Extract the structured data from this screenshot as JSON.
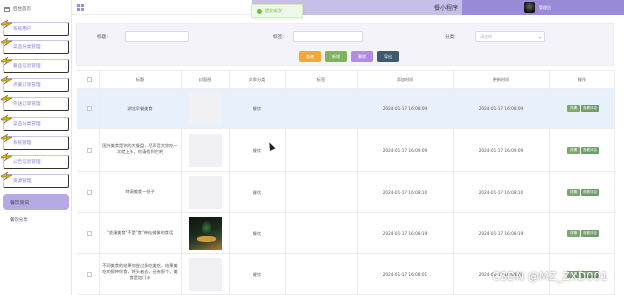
{
  "sidebar": {
    "home_label": "后台首页",
    "items": [
      {
        "label": "系统用户"
      },
      {
        "label": "菜品分类管理"
      },
      {
        "label": "餐品信息管理"
      },
      {
        "label": "点餐订单管理"
      },
      {
        "label": "外送订单管理"
      },
      {
        "label": "菜品分类管理"
      },
      {
        "label": "系统管理"
      },
      {
        "label": "公告信息管理"
      },
      {
        "label": "资源管理"
      }
    ],
    "active_item": "餐饮资讯",
    "sub_item": "餐饮分享"
  },
  "header": {
    "title": "餐小程序",
    "user_name": "管理员"
  },
  "toast": {
    "text": "提交成功!"
  },
  "search": {
    "field1_label": "标题:",
    "field2_label": "标签:",
    "field3_label": "分类:",
    "select_placeholder": "请选择",
    "buttons": {
      "search": "查询",
      "add": "新增",
      "delete": "删除",
      "export": "导出"
    }
  },
  "colors": {
    "accent_purple": "#9a8ad8",
    "btn_search": "#f3a735",
    "btn_add": "#7fb35f",
    "btn_delete": "#b28be3",
    "btn_export": "#3f5a6e"
  },
  "table": {
    "headers": [
      "标题",
      "封面图",
      "文章分类",
      "标签",
      "添加时间",
      "更新时间",
      "操作"
    ],
    "rows": [
      {
        "title": "湖北早餐美食",
        "category": "餐饮",
        "added": "2024-01-17 16:08:09",
        "updated": "2024-01-17 16:08:09"
      },
      {
        "title": "国外美食是你的大餐盘，尽声音大你吃一次就上头，你请找到它吧",
        "category": "餐饮",
        "added": "2024-01-17 16:09:09",
        "updated": "2024-01-17 16:09:09"
      },
      {
        "title": "特调美食一份子",
        "category": "餐饮",
        "added": "2024-01-17 16:08:10",
        "updated": "2024-01-17 16:08:10"
      },
      {
        "title": "\"浪漫美食\"不是\"食\"神仙佛像的食话",
        "category": "餐饮",
        "added": "2024-01-17 16:08:19",
        "updated": "2024-01-17 16:08:19"
      },
      {
        "title": "不同美食的结果你尝过多吃美吃，结果美吃的那种你食，将头者去，还有那个，美食是加门水",
        "category": "餐饮",
        "added": "2024-01-17 16:08:01",
        "updated": "2024-01-17 16:08:01"
      }
    ],
    "action_detail": "详情",
    "action_view": "查看评论"
  },
  "watermark": "CSDN @MZ_ZXD001"
}
